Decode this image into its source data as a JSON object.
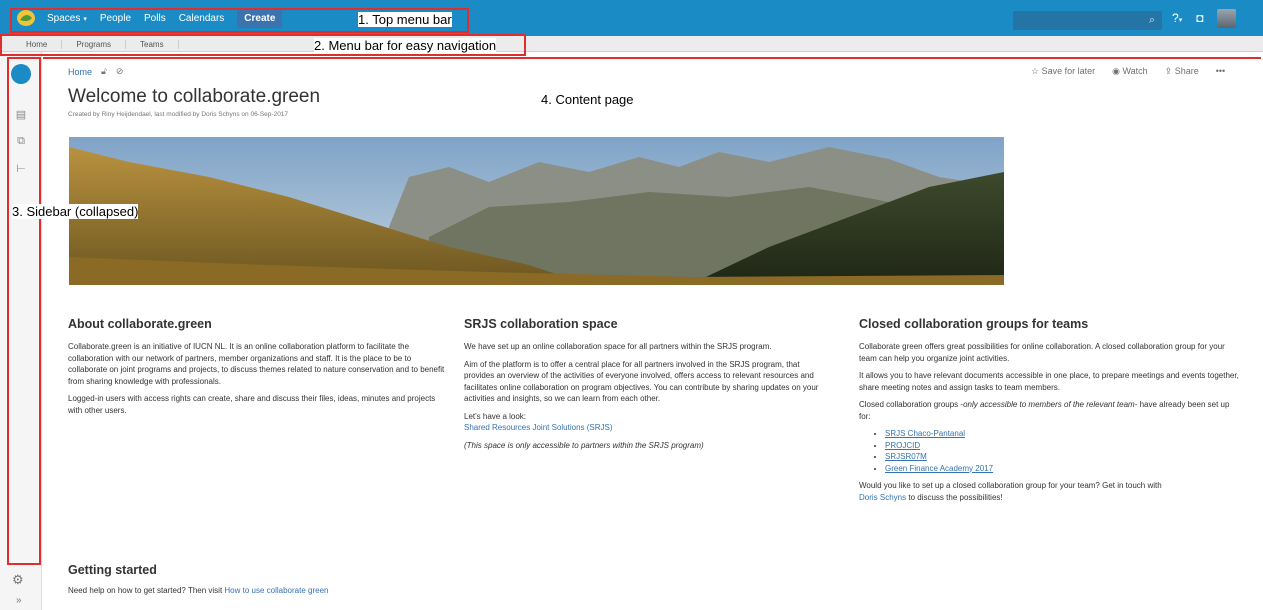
{
  "topbar": {
    "nav": [
      {
        "label": "Spaces",
        "caret": "▾"
      },
      {
        "label": "People"
      },
      {
        "label": "Polls"
      },
      {
        "label": "Calendars"
      }
    ],
    "create_label": "Create",
    "search_placeholder": "",
    "icons": [
      "help-icon",
      "notifications-icon",
      "user-avatar"
    ]
  },
  "subbar": {
    "items": [
      "Home",
      "Programs",
      "Teams"
    ]
  },
  "annotations": {
    "top_menu": "1. Top menu bar",
    "menu_bar": "2. Menu bar for easy navigation",
    "sidebar": "3. Sidebar (collapsed)",
    "content": "4. Content page"
  },
  "breadcrumb": {
    "home": "Home"
  },
  "page_actions": {
    "save": "Save for later",
    "watch": "Watch",
    "share": "Share",
    "more": "•••"
  },
  "page": {
    "title": "Welcome to collaborate.green",
    "byline": "Created by Riny Heijdendael, last modified by Doris Schyns on 06-Sep-2017"
  },
  "about": {
    "heading": "About collaborate.green",
    "p1": "Collaborate.green is an initiative of IUCN NL. It is an online collaboration platform to facilitate the collaboration with our network of partners, member organizations and staff. It is the place to be to collaborate on joint programs and projects, to discuss themes related to nature conservation and to benefit from sharing knowledge with professionals.",
    "p2": "Logged-in users with access rights can create, share and discuss their files, ideas, minutes and projects with other users."
  },
  "srjs": {
    "heading": "SRJS collaboration space",
    "p1": "We have set up an online collaboration space for all partners within the SRJS program.",
    "p2": "Aim of the platform is to offer a central place for all partners involved in the SRJS program, that provides an overview of the activities of everyone involved, offers access to relevant resources and facilitates online collaboration on program objectives. You can contribute by sharing updates on your activities and insights, so we can learn from each other.",
    "p3": "Let's have a look:",
    "link": "Shared Resources Joint Solutions (SRJS)",
    "note": "(This space is only accessible to partners within the SRJS program)"
  },
  "closed": {
    "heading": "Closed collaboration groups for teams",
    "p1": "Collaborate green offers great possibilities for online collaboration. A closed collaboration group for your team can help you organize joint activities.",
    "p2": "It allows you to have relevant documents accessible in one place, to prepare meetings and events together, share meeting notes and assign tasks to team members.",
    "p3_a": "Closed collaboration groups -",
    "p3_b": "only accessible to members of the relevant team",
    "p3_c": "- have already been set up for:",
    "groups": [
      "SRJS Chaco-Pantanal",
      "PROJCID",
      "SRJSR07M",
      "Green Finance Academy 2017"
    ],
    "p4": "Would you like to set up a closed collaboration group for your team? Get in touch with",
    "contact": "Doris Schyns",
    "p4_end": "to discuss the possibilities!"
  },
  "getting_started": {
    "heading": "Getting started",
    "text": "Need help on how to get started? Then visit",
    "link": "How to use collaborate green"
  },
  "colors": {
    "topbar": "#1a8bc4",
    "link": "#3572b0",
    "annotation": "#e02d2d"
  }
}
